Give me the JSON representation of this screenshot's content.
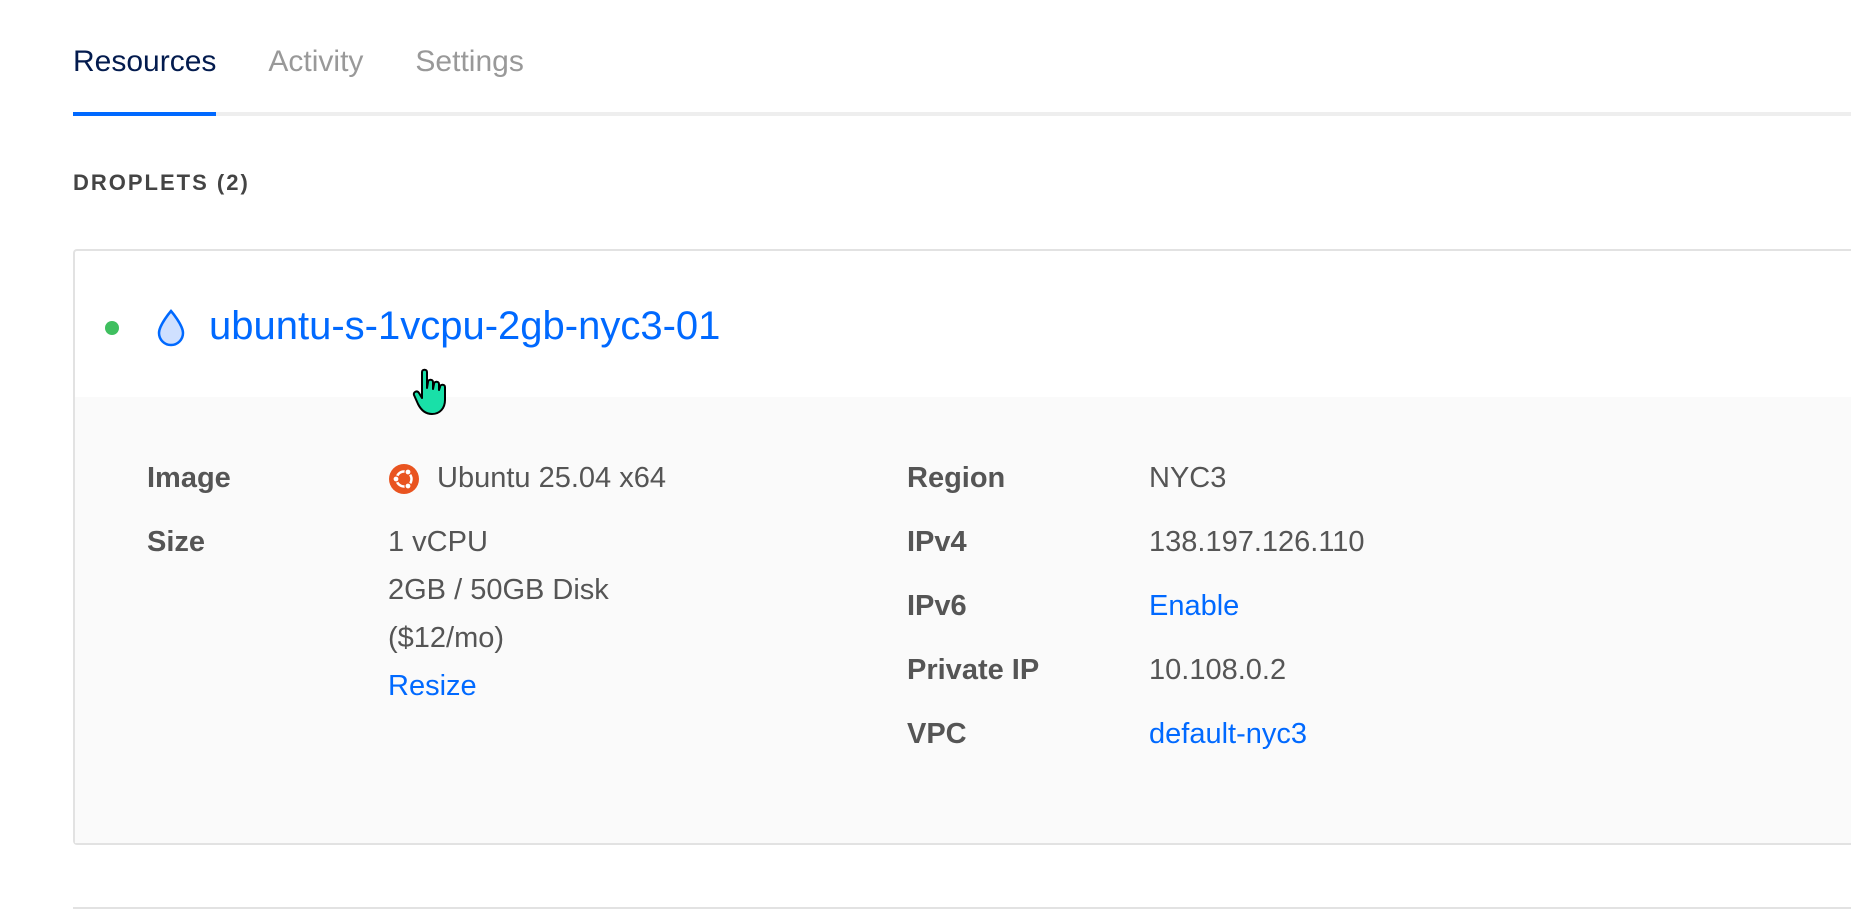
{
  "tabs": [
    {
      "label": "Resources",
      "active": true
    },
    {
      "label": "Activity",
      "active": false
    },
    {
      "label": "Settings",
      "active": false
    }
  ],
  "section": {
    "title": "DROPLETS (2)"
  },
  "droplet": {
    "name": "ubuntu-s-1vcpu-2gb-nyc3-01",
    "status_color": "#3fbf5f",
    "details": {
      "image_label": "Image",
      "image_value": "Ubuntu 25.04 x64",
      "size_label": "Size",
      "size_line1": "1 vCPU",
      "size_line2": "2GB / 50GB Disk",
      "size_line3": "($12/mo)",
      "resize_link": "Resize",
      "region_label": "Region",
      "region_value": "NYC3",
      "ipv4_label": "IPv4",
      "ipv4_value": "138.197.126.110",
      "ipv6_label": "IPv6",
      "ipv6_value": "Enable",
      "private_ip_label": "Private IP",
      "private_ip_value": "10.108.0.2",
      "vpc_label": "VPC",
      "vpc_value": "default-nyc3"
    }
  },
  "colors": {
    "accent": "#0069ff",
    "title": "#031b4e",
    "ubuntu": "#e95420"
  }
}
